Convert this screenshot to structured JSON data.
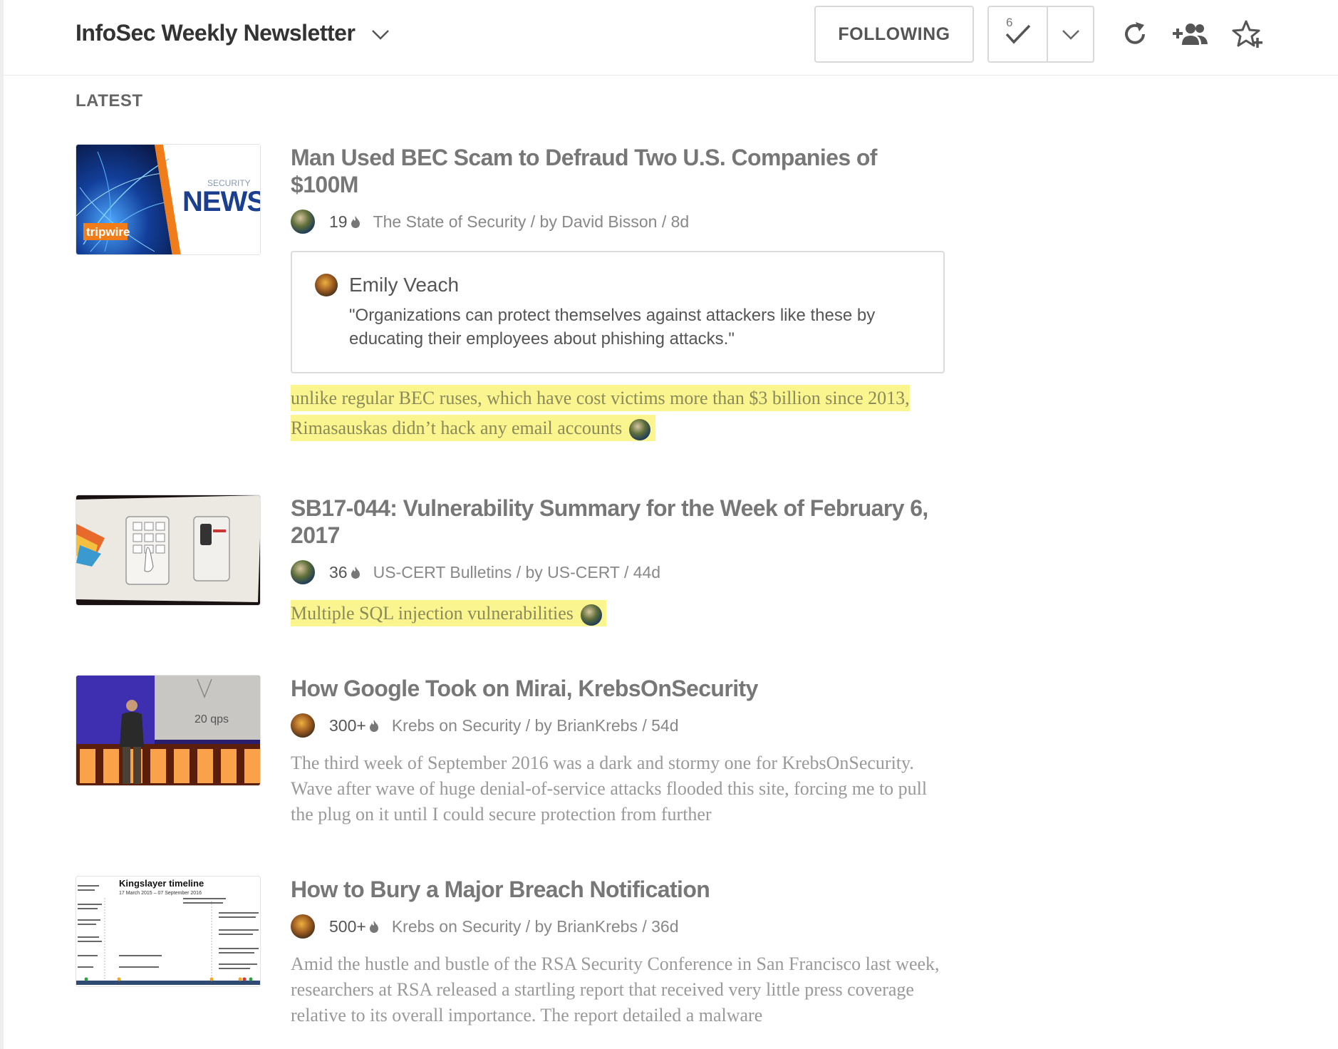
{
  "header": {
    "title": "InfoSec Weekly Newsletter",
    "following_label": "FOLLOWING",
    "unread_count": "6",
    "icons": {
      "title_dropdown": "chevron-down-icon",
      "mark_read": "checkmark-icon",
      "mark_read_menu": "chevron-down-icon",
      "refresh": "refresh-icon",
      "share": "add-people-icon",
      "favorite": "star-plus-icon"
    }
  },
  "section": {
    "label": "LATEST"
  },
  "articles": [
    {
      "title": "Man Used BEC Scam to Defraud Two U.S. Companies of $100M",
      "count": "19",
      "source": "The State of Security / by David Bisson / 8d",
      "thumb": {
        "kind": "security-news",
        "label_small": "SECURITY",
        "label_big": "NEWS",
        "brand": "tripwire"
      },
      "comment": {
        "author": "Emily Veach",
        "text": "\"Organizations can protect themselves against attackers like these by educating their employees about phishing attacks.\""
      },
      "highlight": "unlike regular BEC ruses, which have cost victims more than $3 billion since 2013, Rimasauskas didn’t hack any email accounts"
    },
    {
      "title": "SB17-044: Vulnerability Summary for the Week of February 6, 2017",
      "count": "36",
      "source": "US-CERT Bulletins / by US-CERT / 44d",
      "thumb": {
        "kind": "keypad-photo"
      },
      "highlight": "Multiple SQL injection vulnerabilities"
    },
    {
      "title": "How Google Took on Mirai, KrebsOnSecurity",
      "count": "300+",
      "source": "Krebs on Security / by BrianKrebs / 54d",
      "thumb": {
        "kind": "presenter-photo",
        "slide_text": "20 qps"
      },
      "summary": "The third week of September 2016 was a dark and stormy one for KrebsOnSecurity. Wave after wave of huge denial-of-service attacks flooded this site, forcing me to pull the plug on it until I could secure protection from further"
    },
    {
      "title": "How to Bury a Major Breach Notification",
      "count": "500+",
      "source": "Krebs on Security / by BrianKrebs / 36d",
      "thumb": {
        "kind": "timeline-chart",
        "title": "Kingslayer timeline",
        "subtitle": "17 March 2015 – 07 September 2016"
      },
      "summary": "Amid the hustle and bustle of the RSA Security Conference in San Francisco last week, researchers at RSA released a startling report that received very little press coverage relative to its overall importance. The report detailed a malware"
    }
  ]
}
